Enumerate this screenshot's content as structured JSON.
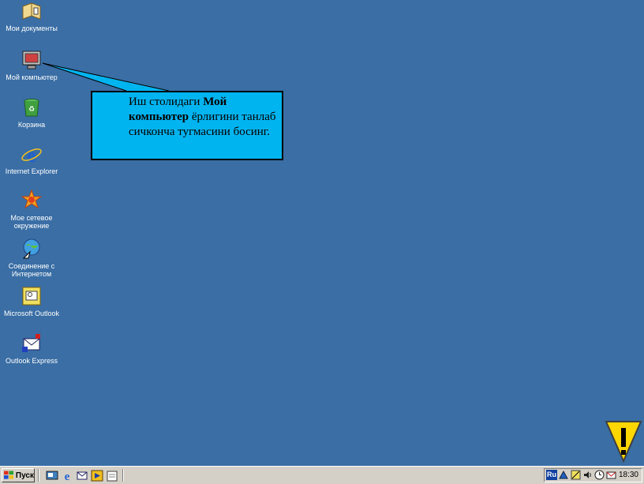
{
  "desktop": {
    "icons": [
      {
        "label": "Мои документы",
        "icon": "my-documents-icon"
      },
      {
        "label": "Мой компьютер",
        "icon": "my-computer-icon"
      },
      {
        "label": "Корзина",
        "icon": "recycle-bin-icon"
      },
      {
        "label": "Internet Explorer",
        "icon": "internet-explorer-icon"
      },
      {
        "label": "Мое сетевое окружение",
        "icon": "network-neighborhood-icon"
      },
      {
        "label": "Соединение с Интернетом",
        "icon": "internet-connection-icon"
      },
      {
        "label": "Microsoft Outlook",
        "icon": "outlook-icon"
      },
      {
        "label": "Outlook Express",
        "icon": "outlook-express-icon"
      }
    ]
  },
  "callout": {
    "text_before": "Иш столидаги ",
    "bold_text": "Мой компьютер",
    "text_after": " ёрлигини танлаб сичконча тугмасини босинг."
  },
  "taskbar": {
    "start_label": "Пуск",
    "tray": {
      "language": "Ru",
      "clock": "18:30"
    }
  },
  "colors": {
    "desktop": "#3a6ea5",
    "callout_fill": "#00b4f0",
    "taskbar": "#d4d0c8",
    "warning_fill": "#ffd700"
  }
}
